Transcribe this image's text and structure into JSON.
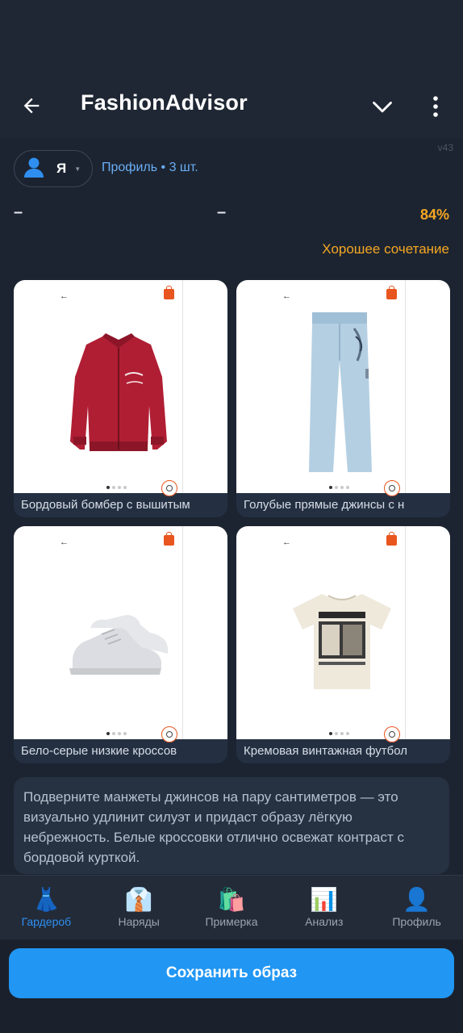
{
  "app": {
    "title": "FashionAdvisor",
    "version": "v43"
  },
  "icons": {
    "back": "arrow-left-icon",
    "expand": "chevron-down-icon",
    "more": "more-vertical-icon",
    "avatar": "user-icon"
  },
  "profile": {
    "chip_label": "Я",
    "info": "Профиль • 3 шт."
  },
  "score": {
    "left_dash": "–",
    "mid_dash": "–",
    "percent": "84%",
    "verdict": "Хорошее сочетание",
    "color": "#f5a623"
  },
  "items": [
    {
      "caption": "Бордовый бомбер с вышитым",
      "icon": "bomber-jacket-image"
    },
    {
      "caption": "Голубые прямые джинсы с н",
      "icon": "jeans-image"
    },
    {
      "caption": "Бело-серые низкие кроссов",
      "icon": "sneakers-image"
    },
    {
      "caption": "Кремовая винтажная футбол",
      "icon": "tshirt-image"
    }
  ],
  "advice": "Подверните манжеты джинсов на пару сантиметров — это визуально удлинит силуэт и придаст образу лёгкую небрежность. Белые кроссовки отлично освежат контраст с бордовой курткой.",
  "nav": [
    {
      "label": "Гардероб",
      "icon": "👗",
      "active": true
    },
    {
      "label": "Наряды",
      "icon": "👔"
    },
    {
      "label": "Примерка",
      "icon": "🛍️"
    },
    {
      "label": "Анализ",
      "icon": "📊"
    },
    {
      "label": "Профиль",
      "icon": "👤"
    }
  ],
  "save_button": "Сохранить образ",
  "colors": {
    "accent": "#2196f3",
    "background": "#1e2633",
    "score": "#f5a623"
  }
}
